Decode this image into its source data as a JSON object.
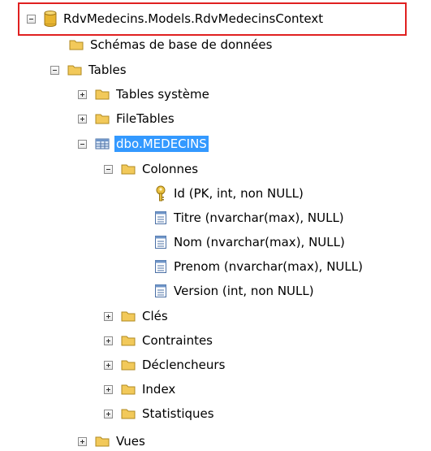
{
  "tree": {
    "root": {
      "label": "RdvMedecins.Models.RdvMedecinsContext",
      "icon": "database-icon"
    },
    "schemas": {
      "label": "Schémas de base de données",
      "icon": "folder-icon"
    },
    "tables": {
      "label": "Tables",
      "icon": "folder-icon"
    },
    "system_tables": {
      "label": "Tables système",
      "icon": "folder-icon"
    },
    "file_tables": {
      "label": "FileTables",
      "icon": "folder-icon"
    },
    "medecins": {
      "label": "dbo.MEDECINS",
      "icon": "table-icon"
    },
    "columns": {
      "label": "Colonnes",
      "icon": "folder-icon",
      "items": [
        {
          "label": "Id (PK, int, non NULL)",
          "icon": "key-icon"
        },
        {
          "label": "Titre (nvarchar(max), NULL)",
          "icon": "column-icon"
        },
        {
          "label": "Nom (nvarchar(max), NULL)",
          "icon": "column-icon"
        },
        {
          "label": "Prenom (nvarchar(max), NULL)",
          "icon": "column-icon"
        },
        {
          "label": "Version (int, non NULL)",
          "icon": "column-icon"
        }
      ]
    },
    "keys": {
      "label": "Clés",
      "icon": "folder-icon"
    },
    "constraints": {
      "label": "Contraintes",
      "icon": "folder-icon"
    },
    "triggers": {
      "label": "Déclencheurs",
      "icon": "folder-icon"
    },
    "indexes": {
      "label": "Index",
      "icon": "folder-icon"
    },
    "statistics": {
      "label": "Statistiques",
      "icon": "folder-icon"
    },
    "views": {
      "label": "Vues",
      "icon": "folder-icon"
    }
  },
  "colors": {
    "selection": "#3399ff",
    "highlight_border": "#e02020",
    "folder": "#f2c95a"
  }
}
